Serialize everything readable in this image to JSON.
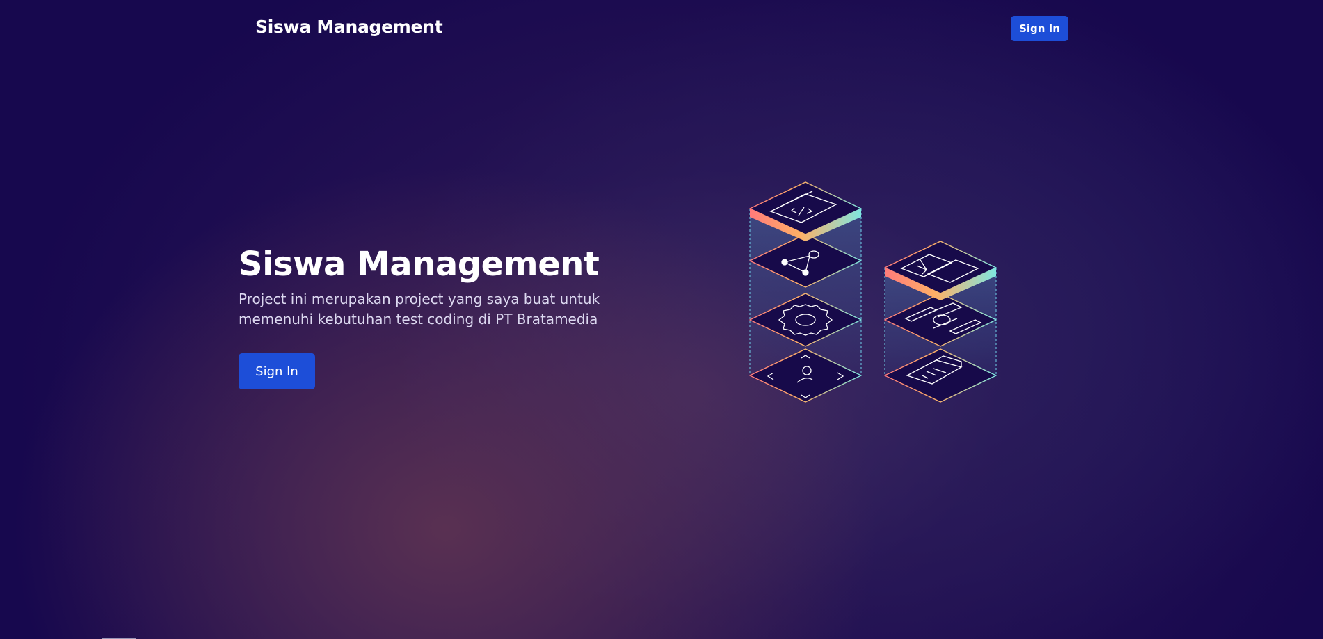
{
  "navbar": {
    "brand": "Siswa Management",
    "signin_label": "Sign In"
  },
  "hero": {
    "title": "Siswa Management",
    "description": "Project ini merupakan project yang saya buat untuk memenuhi kebutuhan test coding di PT Bratamedia",
    "signin_label": "Sign In"
  },
  "colors": {
    "background": "#17084e",
    "button": "#1d4ed8",
    "tile_fill": "#170a4a"
  },
  "illustration": {
    "icons": [
      "code-window-icon",
      "nodes-network-icon",
      "gear-icon",
      "user-code-icon",
      "stacked-windows-icon",
      "circuit-gear-icon",
      "document-icon"
    ]
  }
}
